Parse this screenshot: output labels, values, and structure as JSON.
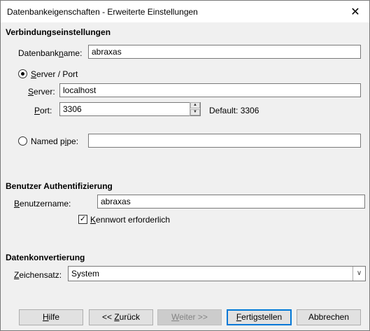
{
  "window": {
    "title": "Datenbankeigenschaften - Erweiterte Einstellungen",
    "close_glyph": "✕"
  },
  "connection": {
    "header": "Verbindungseinstellungen",
    "db_label_pre": "Datenbank",
    "db_label_u": "n",
    "db_label_post": "ame:",
    "db_value": "abraxas",
    "server_port_label_pre": "S",
    "server_port_label_post": "erver / Port",
    "server_label_u": "S",
    "server_label_post": "erver:",
    "server_value": "localhost",
    "port_label_u": "P",
    "port_label_post": "ort:",
    "port_value": "3306",
    "port_default": "Default: 3306",
    "named_pipe_label_pre": "Named p",
    "named_pipe_label_u": "i",
    "named_pipe_label_post": "pe:",
    "named_pipe_value": ""
  },
  "auth": {
    "header": "Benutzer Authentifizierung",
    "user_label_u": "B",
    "user_label_post": "enutzername:",
    "user_value": "abraxas",
    "password_label_u": "K",
    "password_label_post": "ennwort erforderlich"
  },
  "conversion": {
    "header": "Datenkonvertierung",
    "charset_label_u": "Z",
    "charset_label_post": "eichensatz:",
    "charset_value": "System"
  },
  "buttons": {
    "help_u": "H",
    "help_post": "ilfe",
    "back_pre": "<< ",
    "back_u": "Z",
    "back_post": "urück",
    "next_u": "W",
    "next_post": "eiter >>",
    "finish_u": "F",
    "finish_post": "ertigstellen",
    "cancel": "Abbrechen"
  },
  "icons": {
    "checkmark": "✓",
    "spin_up": "▲",
    "spin_down": "▼",
    "dropdown": "∨"
  }
}
